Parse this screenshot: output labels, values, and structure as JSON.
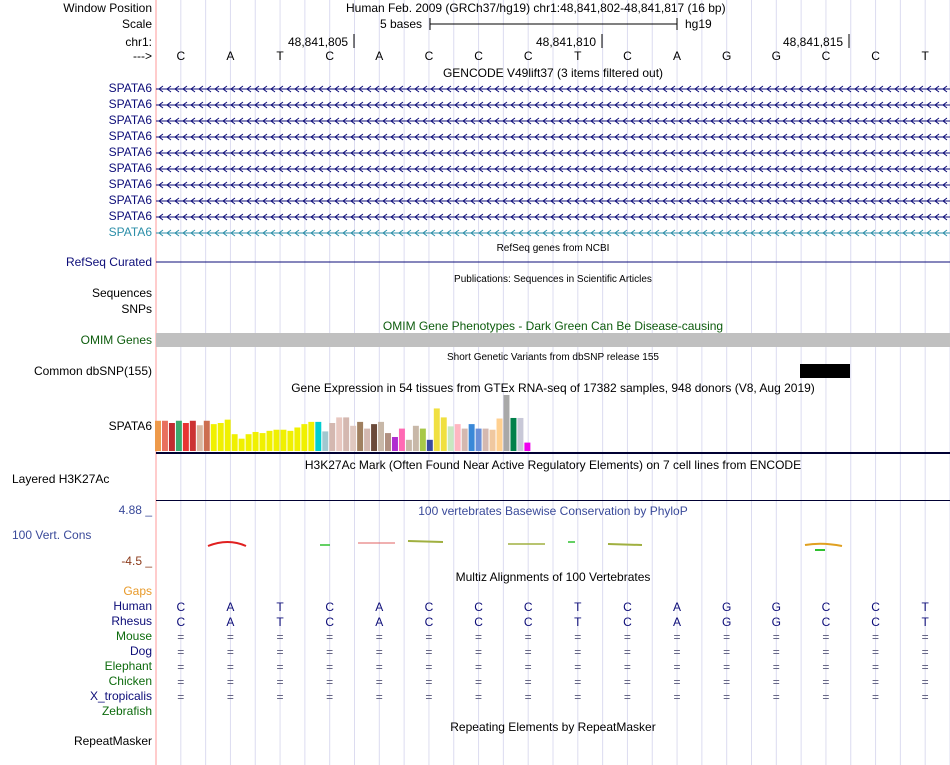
{
  "header": {
    "window_position_label": "Window Position",
    "window_position_value": "Human Feb. 2009 (GRCh37/hg19)   chr1:48,841,802-48,841,817 (16 bp)",
    "scale_label": "Scale",
    "scale_value": "5 bases",
    "scale_assembly": "hg19",
    "chrom_label": "chr1:",
    "positions": [
      "48,841,805",
      "48,841,810",
      "48,841,815"
    ],
    "strand_label": "--->"
  },
  "sequence": [
    "C",
    "A",
    "T",
    "C",
    "A",
    "C",
    "C",
    "C",
    "T",
    "C",
    "A",
    "G",
    "G",
    "C",
    "C",
    "T"
  ],
  "tracks": {
    "gencode": {
      "title": "GENCODE V49lift37 (3 items filtered out)",
      "items": [
        "SPATA6",
        "SPATA6",
        "SPATA6",
        "SPATA6",
        "SPATA6",
        "SPATA6",
        "SPATA6",
        "SPATA6",
        "SPATA6",
        "SPATA6"
      ],
      "color": "#0c0c78",
      "last_color": "#2b8ea8"
    },
    "refseq": {
      "title": "RefSeq genes from NCBI",
      "label": "RefSeq Curated"
    },
    "publications": {
      "title": "Publications: Sequences in Scientific Articles",
      "label1": "Sequences",
      "label2": "SNPs"
    },
    "omim": {
      "title": "OMIM Gene Phenotypes - Dark Green Can Be Disease-causing",
      "label": "OMIM Genes",
      "color": "#0d5c0d"
    },
    "dbsnp": {
      "title": "Short Genetic Variants from dbSNP release 155",
      "label": "Common dbSNP(155)"
    },
    "gtex": {
      "title": "Gene Expression in 54 tissues from GTEx RNA-seq of 17382 samples, 948 donors (V8, Aug 2019)",
      "label": "SPATA6",
      "bar_levels": [
        0.54,
        0.54,
        0.5,
        0.54,
        0.5,
        0.54,
        0.46,
        0.54,
        0.48,
        0.5,
        0.56,
        0.3,
        0.22,
        0.3,
        0.34,
        0.32,
        0.36,
        0.38,
        0.38,
        0.36,
        0.42,
        0.48,
        0.52,
        0.52,
        0.35,
        0.5,
        0.6,
        0.6,
        0.45,
        0.52,
        0.4,
        0.48,
        0.52,
        0.32,
        0.25,
        0.4,
        0.2,
        0.45,
        0.4,
        0.2,
        0.76,
        0.6,
        0.44,
        0.48,
        0.4,
        0.48,
        0.4,
        0.4,
        0.38,
        0.58,
        1.0,
        0.59,
        0.59,
        0.15
      ],
      "bar_colors": [
        "#ee9a4a",
        "#e8705f",
        "#c02c30",
        "#3aaa6e",
        "#e83333",
        "#cc3333",
        "#d9b8a0",
        "#cc6e4f",
        "#f0f000",
        "#f0f000",
        "#f0f000",
        "#f0f000",
        "#f0f000",
        "#f0f000",
        "#f0f000",
        "#f0f000",
        "#f0f000",
        "#f0f000",
        "#f0f000",
        "#f0f000",
        "#f0f000",
        "#f0f000",
        "#f0f000",
        "#00ced1",
        "#a0c8d0",
        "#d4b8b0",
        "#e8c8c0",
        "#d4b8b0",
        "#e0c8c0",
        "#a08060",
        "#d4b8b0",
        "#6b4a3a",
        "#c8b8a8",
        "#b09080",
        "#b02ed0",
        "#ff69b4",
        "#c8b8a8",
        "#c8b8a8",
        "#a8c848",
        "#3a4aa0",
        "#f0e040",
        "#f0e040",
        "#c8e8c0",
        "#ffb6c1",
        "#d4b8b0",
        "#3a88d8",
        "#6a8fd8",
        "#d4b8b0",
        "#f0c8a0",
        "#ffd090",
        "#a8a8a8",
        "#00804a",
        "#c8c8d8",
        "#ee00ee"
      ]
    },
    "h3k27ac": {
      "title": "H3K27Ac Mark (Often Found Near Active Regulatory Elements) on 7 cell lines from ENCODE",
      "label": "Layered H3K27Ac"
    },
    "phylop": {
      "title": "100 vertebrates Basewise Conservation by PhyloP",
      "label": "100 Vert. Cons",
      "max": "4.88 _",
      "min": "-4.5 _",
      "color": "#3a4a9a",
      "min_color": "#8b3a1a"
    },
    "multiz": {
      "title": "Multiz Alignments of 100 Vertebrates",
      "gaps_label": "Gaps",
      "gaps_color": "#e89a2a",
      "species": [
        {
          "name": "Human",
          "color": "#0c0c78",
          "bases": [
            "C",
            "A",
            "T",
            "C",
            "A",
            "C",
            "C",
            "C",
            "T",
            "C",
            "A",
            "G",
            "G",
            "C",
            "C",
            "T"
          ]
        },
        {
          "name": "Rhesus",
          "color": "#0c0c78",
          "bases": [
            "C",
            "A",
            "T",
            "C",
            "A",
            "C",
            "C",
            "C",
            "T",
            "C",
            "A",
            "G",
            "G",
            "C",
            "C",
            "T"
          ]
        },
        {
          "name": "Mouse",
          "color": "#0d6b0d",
          "bases": [
            "=",
            "=",
            "=",
            "=",
            "=",
            "=",
            "=",
            "=",
            "=",
            "=",
            "=",
            "=",
            "=",
            "=",
            "=",
            "="
          ]
        },
        {
          "name": "Dog",
          "color": "#0c0c78",
          "bases": [
            "=",
            "=",
            "=",
            "=",
            "=",
            "=",
            "=",
            "=",
            "=",
            "=",
            "=",
            "=",
            "=",
            "=",
            "=",
            "="
          ]
        },
        {
          "name": "Elephant",
          "color": "#0d6b0d",
          "bases": [
            "=",
            "=",
            "=",
            "=",
            "=",
            "=",
            "=",
            "=",
            "=",
            "=",
            "=",
            "=",
            "=",
            "=",
            "=",
            "="
          ]
        },
        {
          "name": "Chicken",
          "color": "#0d6b0d",
          "bases": [
            "=",
            "=",
            "=",
            "=",
            "=",
            "=",
            "=",
            "=",
            "=",
            "=",
            "=",
            "=",
            "=",
            "=",
            "=",
            "="
          ]
        },
        {
          "name": "X_tropicalis",
          "color": "#0c0c78",
          "bases": [
            "=",
            "=",
            "=",
            "=",
            "=",
            "=",
            "=",
            "=",
            "=",
            "=",
            "=",
            "=",
            "=",
            "=",
            "=",
            "="
          ]
        },
        {
          "name": "Zebrafish",
          "color": "#0d6b0d",
          "bases": []
        }
      ]
    },
    "repeatmasker": {
      "title": "Repeating Elements by RepeatMasker",
      "label": "RepeatMasker"
    }
  }
}
